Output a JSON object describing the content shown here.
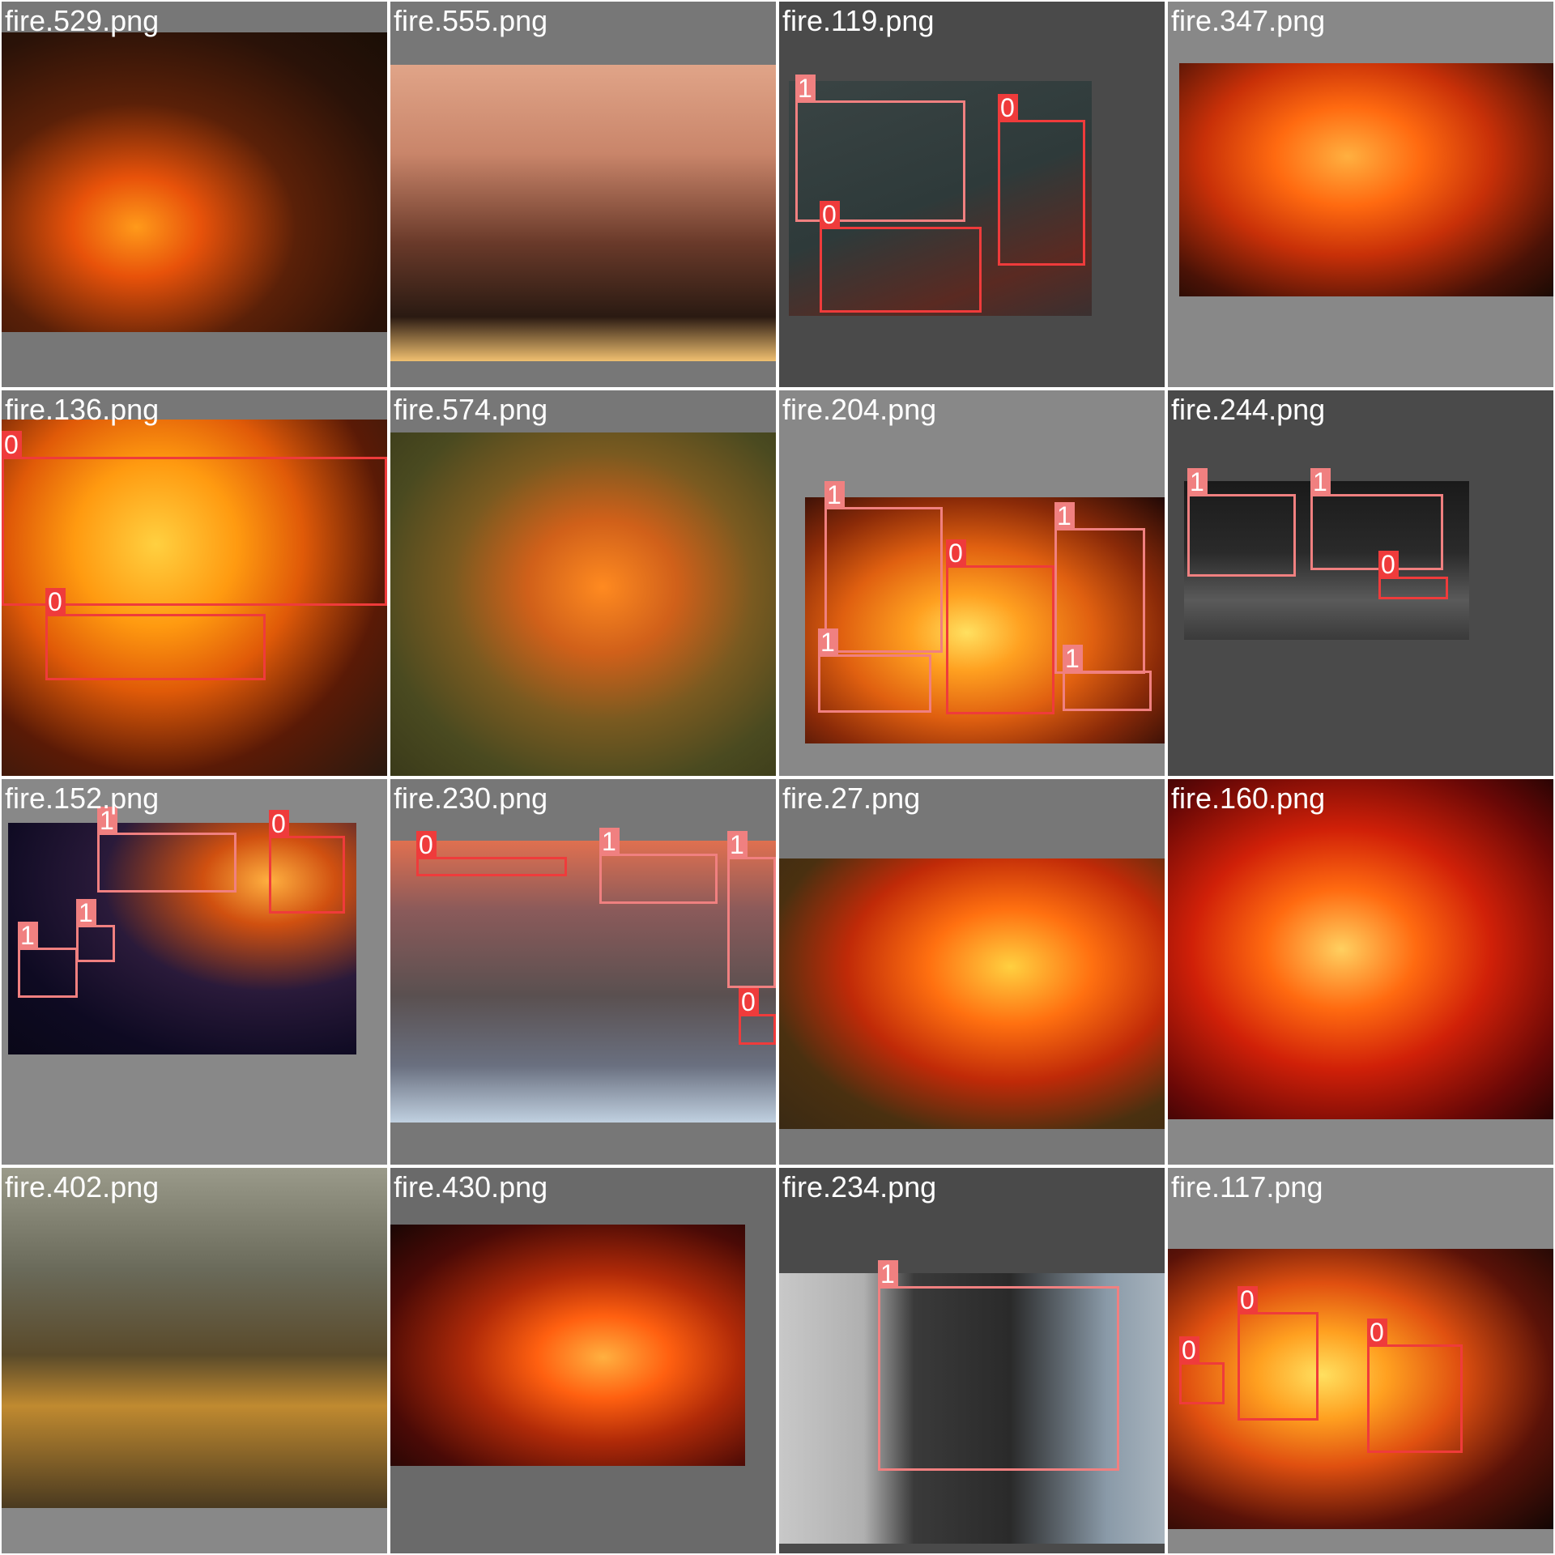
{
  "grid": {
    "cells": [
      {
        "filename": "fire.529.png",
        "bg": "#777777",
        "labels": []
      },
      {
        "filename": "fire.555.png",
        "bg": "#777777",
        "labels": []
      },
      {
        "filename": "fire.119.png",
        "bg": "#4a4a4a",
        "labels": [
          "1",
          "0",
          "0"
        ]
      },
      {
        "filename": "fire.347.png",
        "bg": "#888888",
        "labels": []
      },
      {
        "filename": "fire.136.png",
        "bg": "#777777",
        "labels": [
          "0",
          "0"
        ]
      },
      {
        "filename": "fire.574.png",
        "bg": "#777777",
        "labels": []
      },
      {
        "filename": "fire.204.png",
        "bg": "#888888",
        "labels": [
          "1",
          "1",
          "0",
          "1",
          "1"
        ]
      },
      {
        "filename": "fire.244.png",
        "bg": "#4a4a4a",
        "labels": [
          "1",
          "1",
          "0"
        ]
      },
      {
        "filename": "fire.152.png",
        "bg": "#888888",
        "labels": [
          "1",
          "0",
          "1",
          "1"
        ]
      },
      {
        "filename": "fire.230.png",
        "bg": "#777777",
        "labels": [
          "0",
          "1",
          "1",
          "0"
        ]
      },
      {
        "filename": "fire.27.png",
        "bg": "#777777",
        "labels": []
      },
      {
        "filename": "fire.160.png",
        "bg": "#888888",
        "labels": []
      },
      {
        "filename": "fire.402.png",
        "bg": "#888888",
        "labels": []
      },
      {
        "filename": "fire.430.png",
        "bg": "#6a6a6a",
        "labels": []
      },
      {
        "filename": "fire.234.png",
        "bg": "#4a4a4a",
        "labels": [
          "1"
        ]
      },
      {
        "filename": "fire.117.png",
        "bg": "#888888",
        "labels": [
          "0",
          "0",
          "0"
        ]
      }
    ]
  },
  "colors": {
    "class_0": "#ef3b3b",
    "class_1": "#f08080",
    "filename_text": "#ffffff"
  }
}
